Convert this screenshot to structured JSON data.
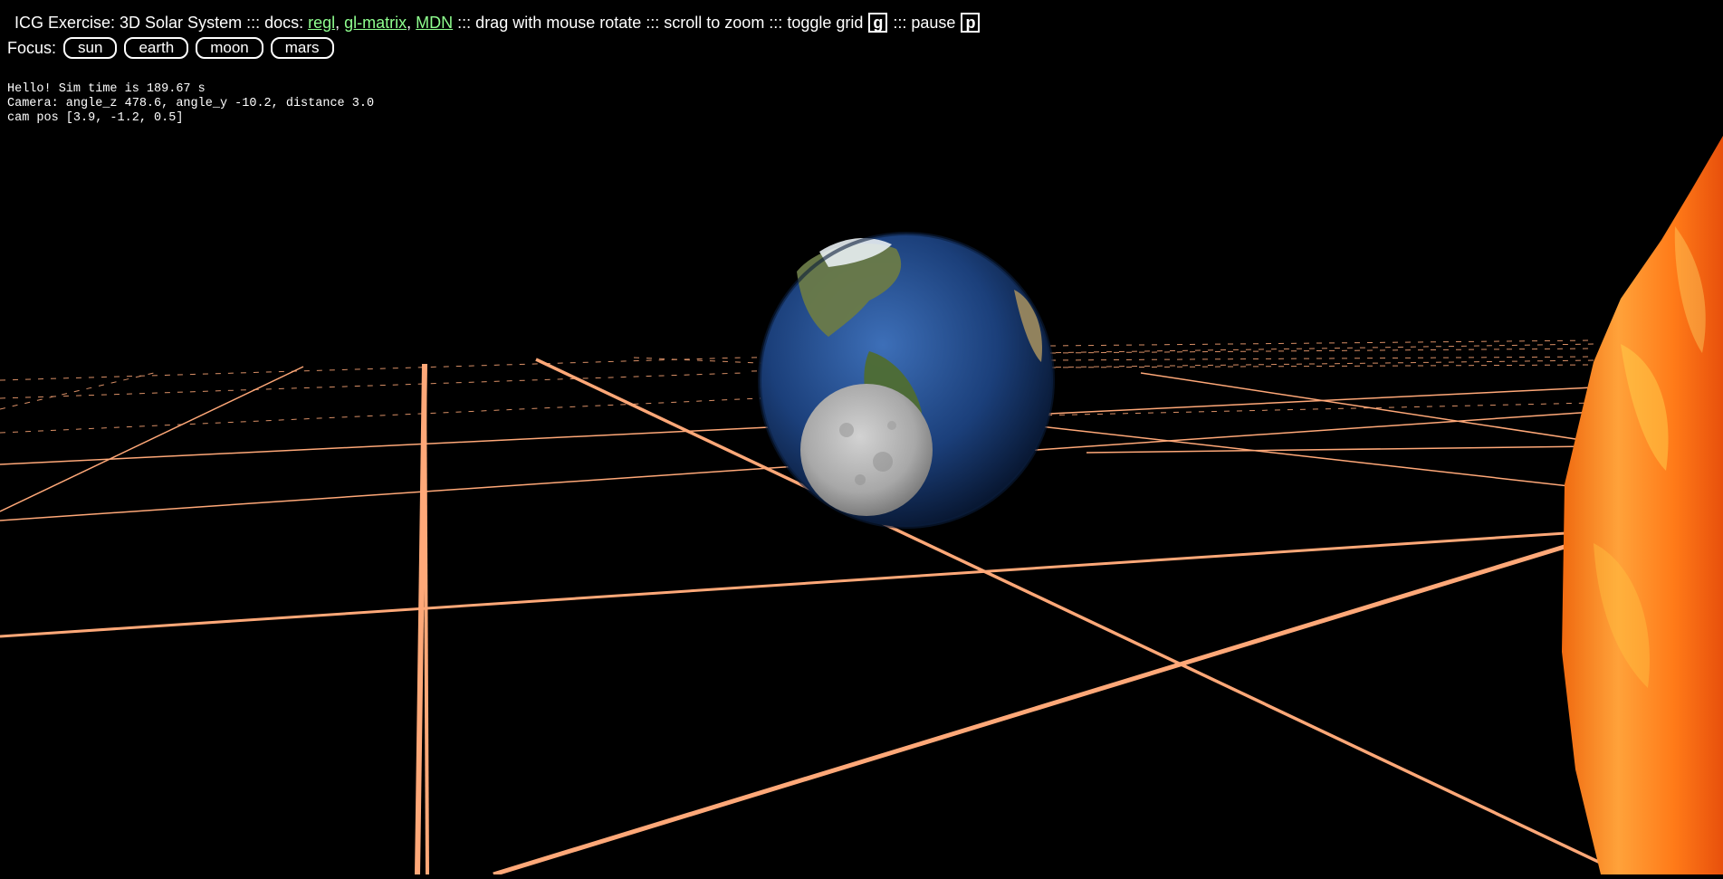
{
  "header": {
    "title": "ICG Exercise: 3D Solar System",
    "sep1": " ::: docs: ",
    "link_regl": "regl",
    "comma1": ", ",
    "link_glmatrix": "gl-matrix",
    "comma2": ", ",
    "link_mdn": "MDN",
    "sep2": " ::: drag with mouse rotate ::: scroll to zoom ::: toggle grid ",
    "key_grid": "g",
    "sep3": " ::: pause ",
    "key_pause": "p"
  },
  "focus": {
    "label": "Focus:",
    "buttons": [
      "sun",
      "earth",
      "moon",
      "mars"
    ]
  },
  "debug": {
    "line1": "Hello! Sim time is 189.67 s",
    "line2": "Camera: angle_z 478.6, angle_y -10.2, distance 3.0",
    "line3": "cam pos [3.9, -1.2, 0.5]"
  },
  "colors": {
    "background": "#000000",
    "grid": "#ffa878",
    "link": "#8fff8f",
    "ocean": "#1f4a8a",
    "land": "#5e7a3a",
    "moon": "#b8b8b8",
    "sun": "#ff8a1c"
  }
}
